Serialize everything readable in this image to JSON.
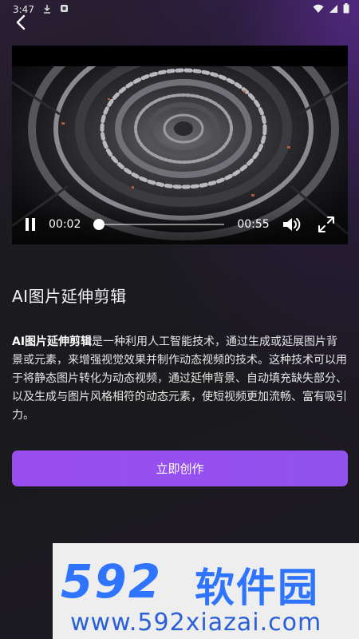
{
  "status_bar": {
    "time": "3:47"
  },
  "video": {
    "current_time": "00:02",
    "total_time": "00:55",
    "progress": 0.04
  },
  "page": {
    "title": "AI图片延伸剪辑",
    "desc_bold": "AI图片延伸剪辑",
    "desc_rest": "是一种利用人工智能技术，通过生成或延展图片背景或元素，来增强视觉效果并制作动态视频的技术。这种技术可以用于将静态图片转化为动态视频，通过延伸背景、自动填充缺失部分、以及生成与图片风格相符的动态元素，使短视频更加流畅、富有吸引力。",
    "create_button": "立即创作"
  },
  "watermark": {
    "logo_num": "592",
    "logo_cn": "软件园",
    "url": "www.592xiazai.com"
  },
  "colors": {
    "accent": "#9a4ef0",
    "watermark": "#2f74ff"
  }
}
